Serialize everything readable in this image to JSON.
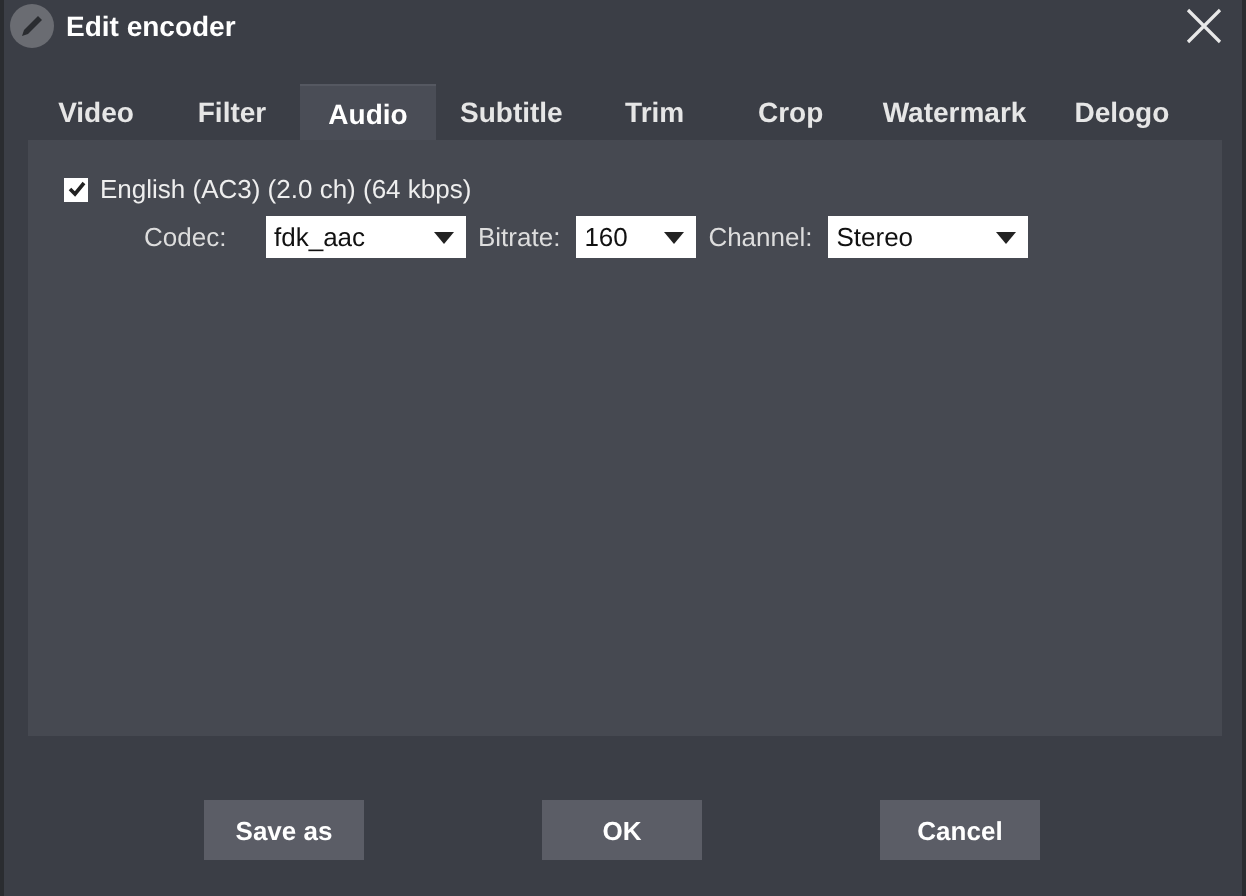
{
  "window": {
    "title": "Edit encoder"
  },
  "tabs": [
    {
      "label": "Video",
      "selected": false
    },
    {
      "label": "Filter",
      "selected": false
    },
    {
      "label": "Audio",
      "selected": true
    },
    {
      "label": "Subtitle",
      "selected": false
    },
    {
      "label": "Trim",
      "selected": false
    },
    {
      "label": "Crop",
      "selected": false
    },
    {
      "label": "Watermark",
      "selected": false
    },
    {
      "label": "Delogo",
      "selected": false
    }
  ],
  "audio_track": {
    "label": "English (AC3) (2.0 ch) (64 kbps)",
    "checked": true,
    "fields": [
      {
        "label": "Codec:",
        "value": "fdk_aac",
        "kind": "wide"
      },
      {
        "label": "Bitrate:",
        "value": "160",
        "kind": "narrow"
      },
      {
        "label": "Channel:",
        "value": "Stereo",
        "kind": "wide"
      }
    ]
  },
  "buttons": [
    "Save as",
    "OK",
    "Cancel"
  ]
}
